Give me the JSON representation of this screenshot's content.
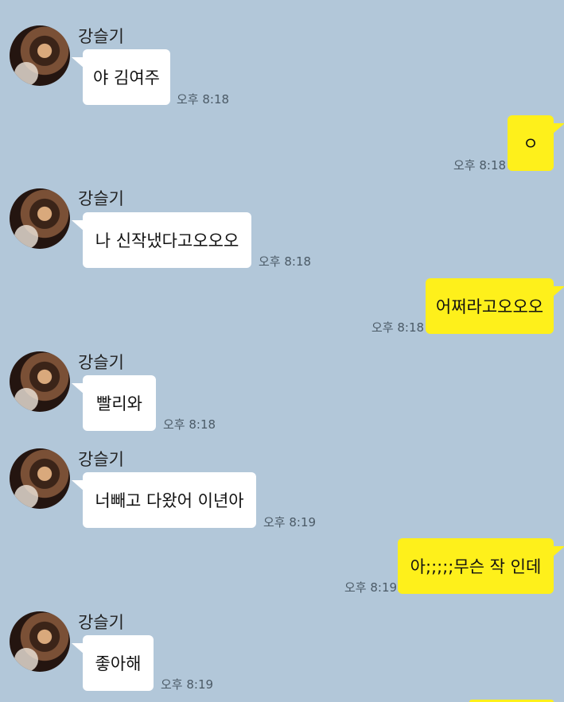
{
  "sender_name": "강슬기",
  "messages": [
    {
      "direction": "in",
      "text": "야 김여주",
      "time": "오후 8:18"
    },
    {
      "direction": "out",
      "text": "ㅇ",
      "time": "오후 8:18"
    },
    {
      "direction": "in",
      "text": "나 신작냈다고오오오",
      "time": "오후 8:18"
    },
    {
      "direction": "out",
      "text": "어쩌라고오오오",
      "time": "오후 8:18"
    },
    {
      "direction": "in",
      "text": "빨리와",
      "time": "오후 8:18"
    },
    {
      "direction": "in",
      "text": "너빼고 다왔어 이년아",
      "time": "오후 8:19"
    },
    {
      "direction": "out",
      "text": "아;;;;;무슨 작 인데",
      "time": "오후 8:19"
    },
    {
      "direction": "in",
      "text": "좋아해",
      "time": "오후 8:19"
    }
  ],
  "colors": {
    "background": "#b2c7d9",
    "incoming_bubble": "#ffffff",
    "outgoing_bubble": "#fef01b"
  }
}
